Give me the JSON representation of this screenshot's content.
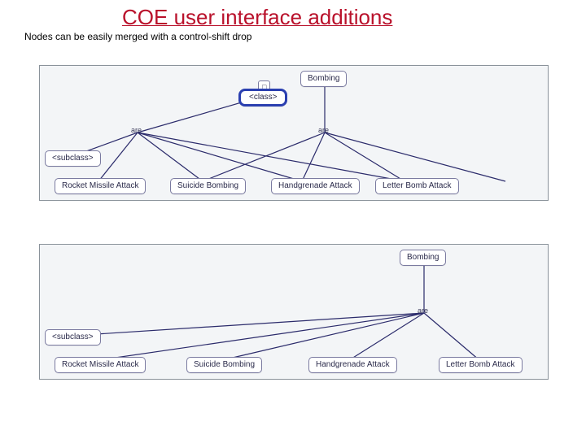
{
  "title": "COE user interface additions",
  "subtitle": "Nodes can be easily  merged with a control-shift drop",
  "diagram1": {
    "bombing": "Bombing",
    "class_node": "<class>",
    "are_left": "are",
    "are_right": "are",
    "subclass": "<subclass>",
    "leaf1": "Rocket Missile Attack",
    "leaf2": "Suicide Bombing",
    "leaf3": "Handgrenade Attack",
    "leaf4": "Letter Bomb Attack"
  },
  "diagram2": {
    "bombing": "Bombing",
    "are": "are",
    "subclass": "<subclass>",
    "leaf1": "Rocket Missile Attack",
    "leaf2": "Suicide Bombing",
    "leaf3": "Handgrenade Attack",
    "leaf4": "Letter Bomb Attack"
  }
}
